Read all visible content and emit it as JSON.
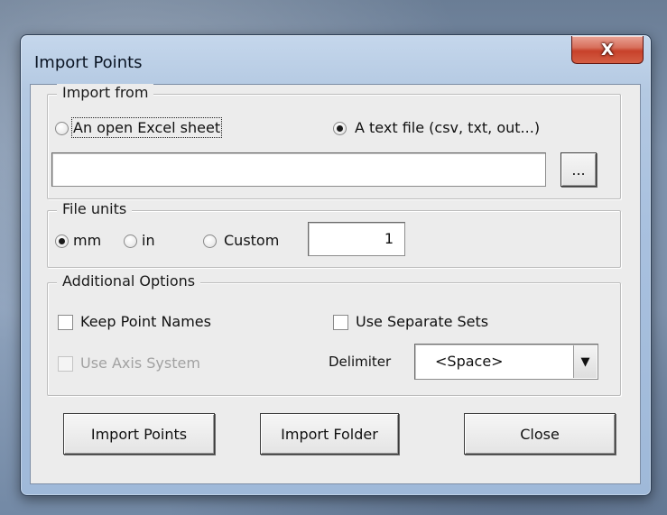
{
  "window": {
    "title": "Import Points",
    "close_glyph": "X"
  },
  "import_from": {
    "legend": "Import from",
    "option_excel": "An open Excel sheet",
    "option_text": "A text file (csv, txt, out...)",
    "selected": "text",
    "file_path_value": "",
    "browse_label": "..."
  },
  "file_units": {
    "legend": "File units",
    "option_mm": "mm",
    "option_in": "in",
    "option_custom": "Custom",
    "selected": "mm",
    "custom_value": "1"
  },
  "additional_options": {
    "legend": "Additional Options",
    "keep_point_names": "Keep Point Names",
    "keep_point_names_checked": false,
    "use_separate_sets": "Use Separate Sets",
    "use_separate_sets_checked": false,
    "use_axis_system": "Use Axis System",
    "use_axis_system_checked": false,
    "delimiter_label": "Delimiter",
    "delimiter_value": "<Space>",
    "dropdown_icon": "chevron-down-icon"
  },
  "buttons": {
    "import_points": "Import Points",
    "import_folder": "Import Folder",
    "close": "Close"
  }
}
